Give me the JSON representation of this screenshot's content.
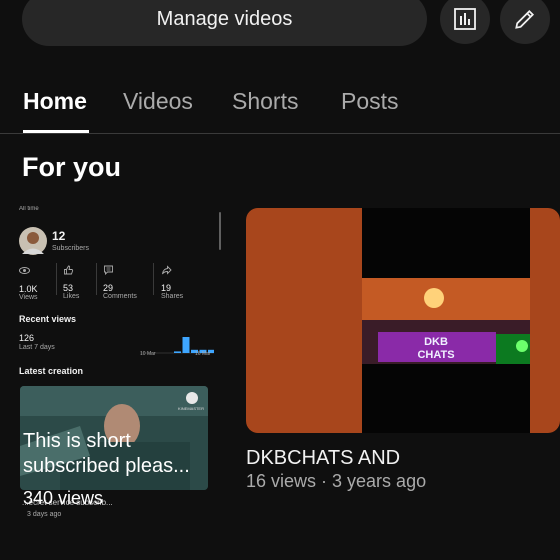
{
  "header": {
    "manage_label": "Manage videos",
    "analytics_icon": "analytics-icon",
    "edit_icon": "pencil-icon"
  },
  "tabs": [
    {
      "label": "Home",
      "active": true
    },
    {
      "label": "Videos",
      "active": false
    },
    {
      "label": "Shorts",
      "active": false
    },
    {
      "label": "Posts",
      "active": false
    }
  ],
  "section_title": "For you",
  "stats": {
    "range": "All time",
    "subscribers_count": "12",
    "subscribers_label": "Subscribers",
    "metrics": [
      {
        "icon": "eye-icon",
        "value": "1.0K",
        "label": "Views"
      },
      {
        "icon": "thumbs-up-icon",
        "value": "53",
        "label": "Likes"
      },
      {
        "icon": "comment-icon",
        "value": "29",
        "label": "Comments"
      },
      {
        "icon": "share-icon",
        "value": "19",
        "label": "Shares"
      }
    ],
    "recent_views_title": "Recent views",
    "recent_views_count": "126",
    "recent_views_period": "Last 7 days",
    "mini_chart_values": [
      0.1,
      1.0,
      0.2,
      0.2,
      0.2
    ],
    "chart_label_start": "10 Mar",
    "chart_label_end": "16 Mar",
    "latest_title": "Latest creation",
    "latest_overlay_line1": "This is short",
    "latest_overlay_line2": "subscribed pleas...",
    "latest_views": "340 views",
    "latest_caption": "...ecret service subscrib...",
    "latest_age": "3 days ago",
    "watermark": "KINEMASTER"
  },
  "video": {
    "title": "DKBCHATS AND",
    "meta": "16 views · 3 years ago",
    "sign_line1": "DKB",
    "sign_line2": "CHATS"
  },
  "colors": {
    "accent": "#3ea6ff",
    "bg": "#0f0f0f",
    "surface": "#272727"
  }
}
